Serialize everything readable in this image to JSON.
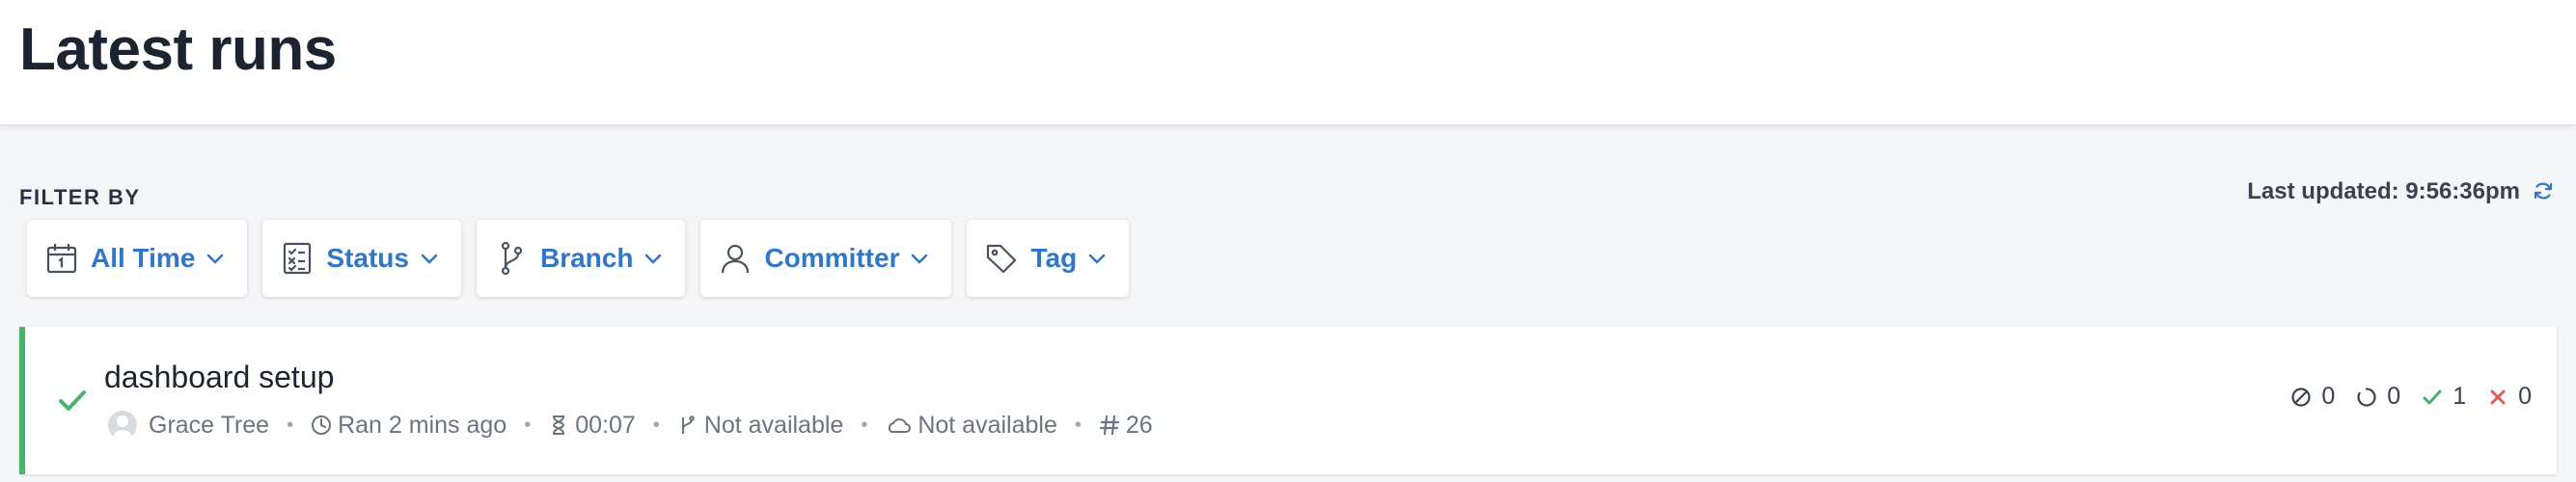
{
  "header": {
    "title": "Latest runs"
  },
  "filters": {
    "label": "FILTER BY",
    "items": [
      {
        "label": "All Time",
        "icon": "calendar-icon"
      },
      {
        "label": "Status",
        "icon": "checklist-icon"
      },
      {
        "label": "Branch",
        "icon": "branch-icon"
      },
      {
        "label": "Committer",
        "icon": "user-icon"
      },
      {
        "label": "Tag",
        "icon": "tag-icon"
      }
    ]
  },
  "last_updated": {
    "text": "Last updated: 9:56:36pm",
    "icon": "refresh-icon"
  },
  "runs": [
    {
      "title": "dashboard setup",
      "status": "passed",
      "committer": "Grace Tree",
      "ran": "Ran 2 mins ago",
      "duration": "00:07",
      "branch": "Not available",
      "environment": "Not available",
      "run_number": "26",
      "counts": {
        "skipped": "0",
        "pending": "0",
        "passed": "1",
        "failed": "0"
      }
    }
  ],
  "colors": {
    "accent": "#3277c6",
    "passed": "#46b46f",
    "failed": "#e25b5b",
    "title": "#1b2430",
    "muted": "#6d7480"
  }
}
